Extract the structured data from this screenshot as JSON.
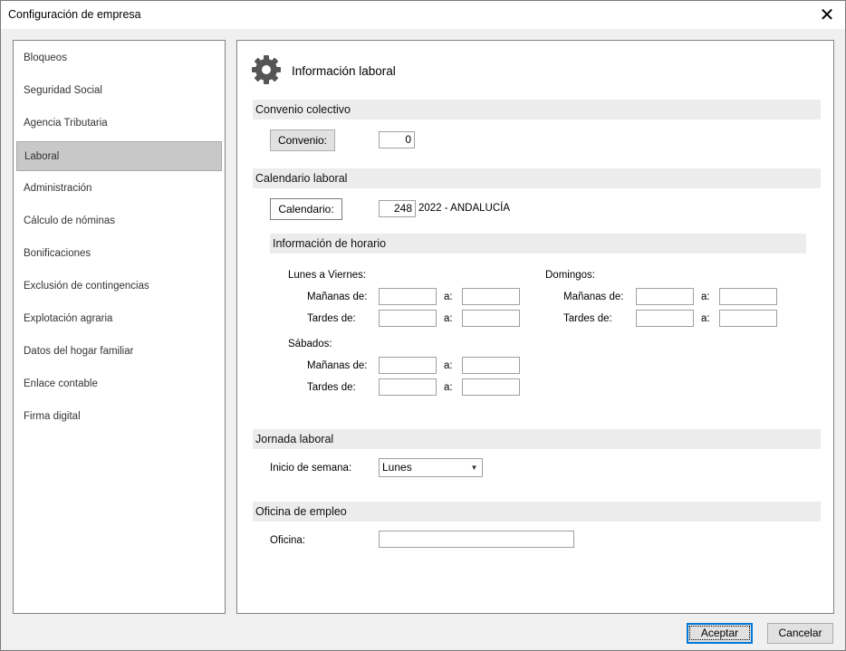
{
  "window": {
    "title": "Configuración de empresa",
    "close_glyph": "✕"
  },
  "sidebar": {
    "items": [
      {
        "label": "Bloqueos"
      },
      {
        "label": "Seguridad Social"
      },
      {
        "label": "Agencia Tributaria"
      },
      {
        "label": "Laboral",
        "active": true
      },
      {
        "label": "Administración"
      },
      {
        "label": "Cálculo de nóminas"
      },
      {
        "label": "Bonificaciones"
      },
      {
        "label": "Exclusión de contingencias"
      },
      {
        "label": "Explotación agraria"
      },
      {
        "label": "Datos del hogar familiar"
      },
      {
        "label": "Enlace contable"
      },
      {
        "label": "Firma digital"
      }
    ]
  },
  "main": {
    "title": "Información laboral",
    "icon": "gear-icon",
    "convenio": {
      "header": "Convenio colectivo",
      "button_label": "Convenio:",
      "value": "0"
    },
    "calendario": {
      "header": "Calendario laboral",
      "button_label": "Calendario:",
      "value": "248",
      "description": "2022 - ANDALUCÍA"
    },
    "horario": {
      "header": "Información de horario",
      "lunes_viernes": "Lunes a Viernes:",
      "sabados": "Sábados:",
      "domingos": "Domingos:",
      "mananas_label": "Mañanas de:",
      "tardes_label": "Tardes de:",
      "a_label": "a:",
      "values": {
        "lv_m_from": "",
        "lv_m_to": "",
        "lv_t_from": "",
        "lv_t_to": "",
        "sa_m_from": "",
        "sa_m_to": "",
        "sa_t_from": "",
        "sa_t_to": "",
        "do_m_from": "",
        "do_m_to": "",
        "do_t_from": "",
        "do_t_to": ""
      }
    },
    "jornada": {
      "header": "Jornada laboral",
      "inicio_label": "Inicio de semana:",
      "inicio_value": "Lunes",
      "arrow": "▼"
    },
    "oficina": {
      "header": "Oficina de empleo",
      "label": "Oficina:",
      "value": ""
    }
  },
  "footer": {
    "accept_label": "Aceptar",
    "cancel_label": "Cancelar"
  }
}
